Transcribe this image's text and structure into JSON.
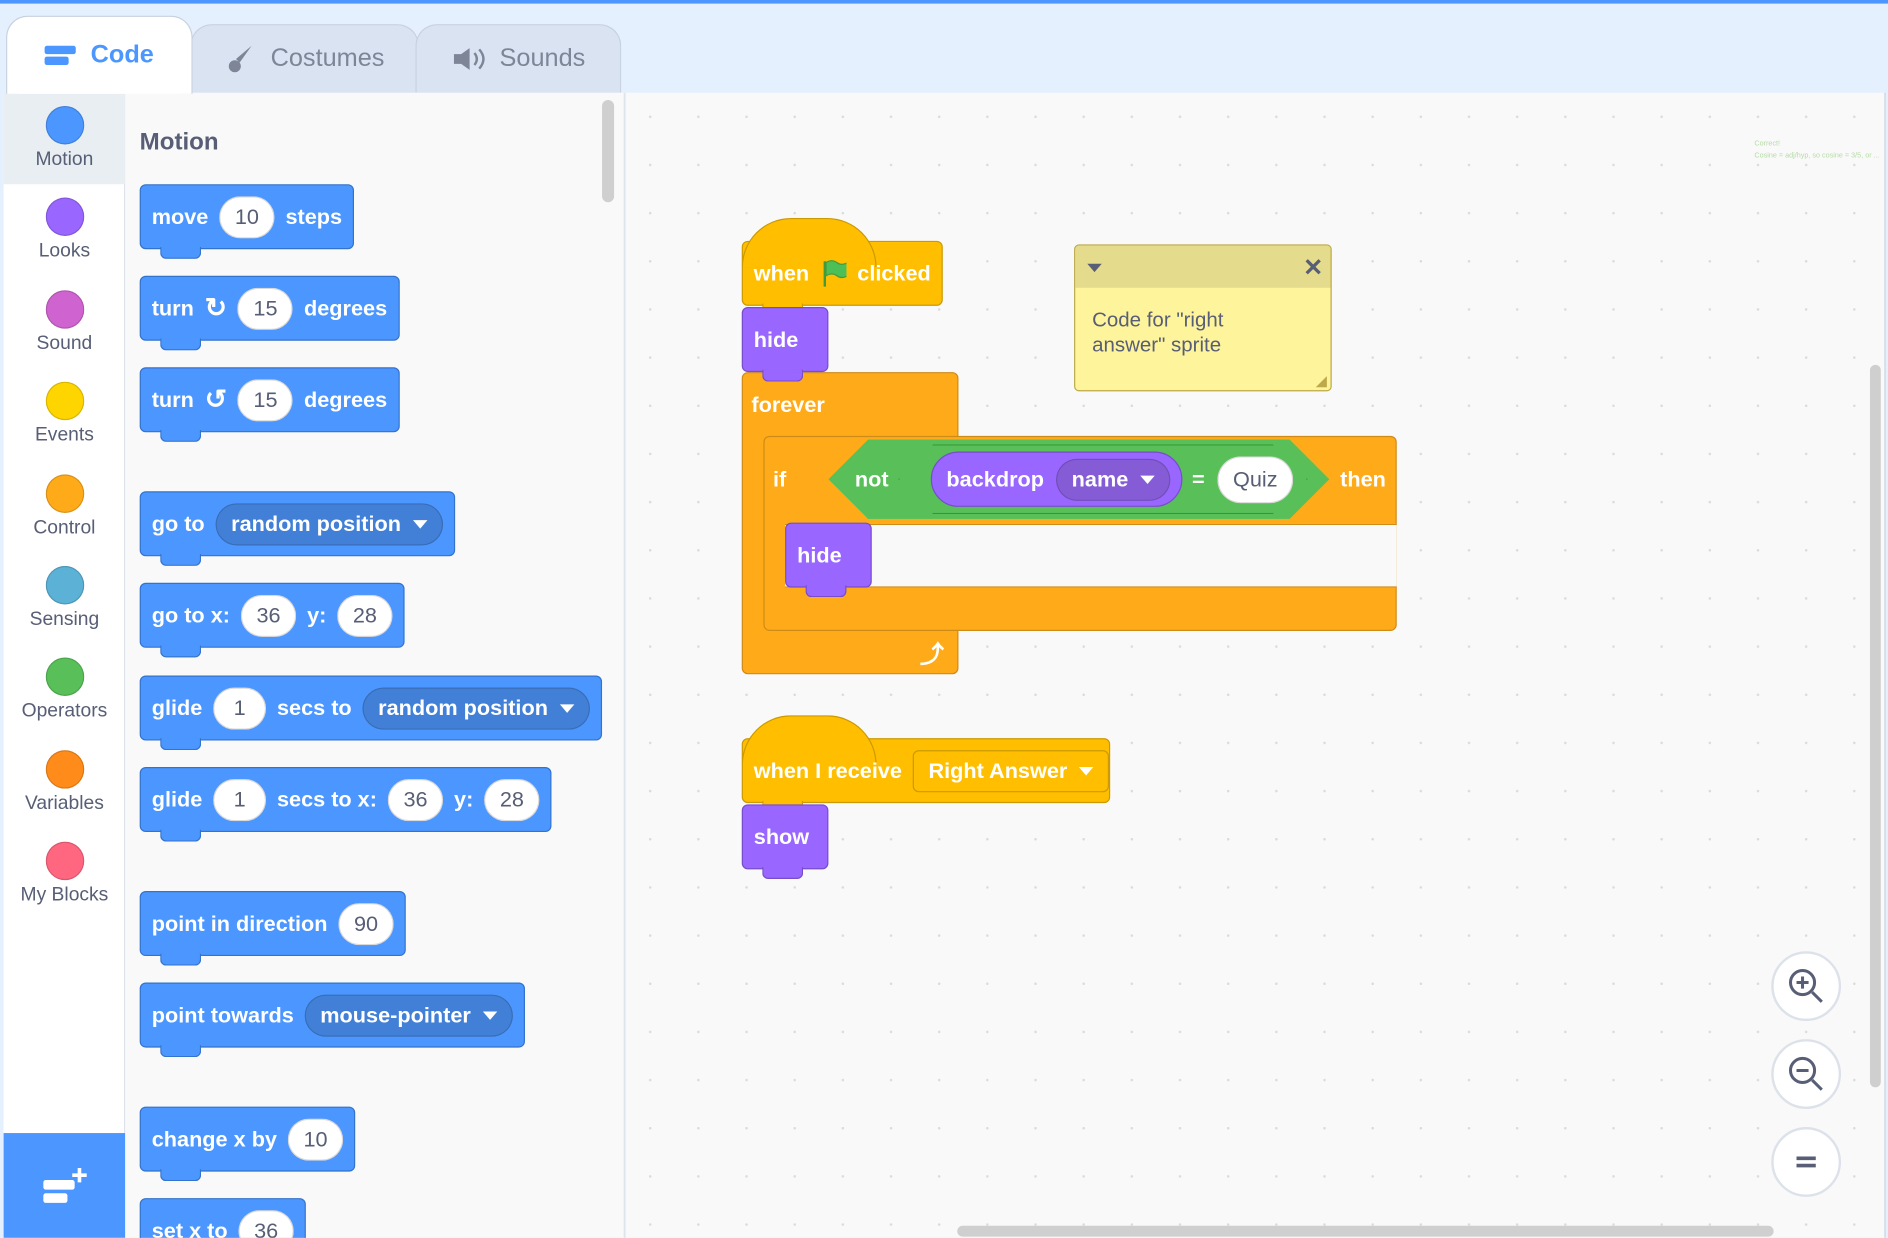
{
  "tabs": [
    {
      "label": "Code",
      "icon": "code-icon"
    },
    {
      "label": "Costumes",
      "icon": "brush-icon"
    },
    {
      "label": "Sounds",
      "icon": "speaker-icon"
    }
  ],
  "categories": [
    {
      "label": "Motion",
      "color": "#4c97ff"
    },
    {
      "label": "Looks",
      "color": "#9966ff"
    },
    {
      "label": "Sound",
      "color": "#cf63cf"
    },
    {
      "label": "Events",
      "color": "#ffd500"
    },
    {
      "label": "Control",
      "color": "#ffab19"
    },
    {
      "label": "Sensing",
      "color": "#5cb1d6"
    },
    {
      "label": "Operators",
      "color": "#59c059"
    },
    {
      "label": "Variables",
      "color": "#ff8c1a"
    },
    {
      "label": "My Blocks",
      "color": "#ff6680"
    }
  ],
  "flyout": {
    "heading": "Motion",
    "move": {
      "a": "move",
      "v": "10",
      "b": "steps"
    },
    "turn_right": {
      "a": "turn",
      "v": "15",
      "b": "degrees"
    },
    "turn_left": {
      "a": "turn",
      "v": "15",
      "b": "degrees"
    },
    "goto": {
      "a": "go to",
      "dd": "random position"
    },
    "gotoxy": {
      "a": "go to x:",
      "x": "36",
      "b": "y:",
      "y": "28"
    },
    "glide": {
      "a": "glide",
      "v": "1",
      "b": "secs to",
      "dd": "random position"
    },
    "glidexy": {
      "a": "glide",
      "v": "1",
      "b": "secs to x:",
      "x": "36",
      "c": "y:",
      "y": "28"
    },
    "point": {
      "a": "point in direction",
      "v": "90"
    },
    "towards": {
      "a": "point towards",
      "dd": "mouse-pointer"
    },
    "changex": {
      "a": "change x by",
      "v": "10"
    },
    "setx": {
      "a": "set x to",
      "v": "36"
    }
  },
  "script1": {
    "when": "when",
    "clicked": "clicked",
    "hide1": "hide",
    "forever": "forever",
    "if": "if",
    "not": "not",
    "backdrop": "backdrop",
    "name": "name",
    "eq": "=",
    "quiz": "Quiz",
    "then": "then",
    "hide2": "hide"
  },
  "script2": {
    "when_receive": "when I receive",
    "message": "Right Answer",
    "show": "show"
  },
  "comment": {
    "text": "Code for \"right answer\" sprite"
  },
  "faint_comment": {
    "line1": "Correct!",
    "line2": "Cosine = adj/hyp, so cosine = 3/5, or ..."
  }
}
